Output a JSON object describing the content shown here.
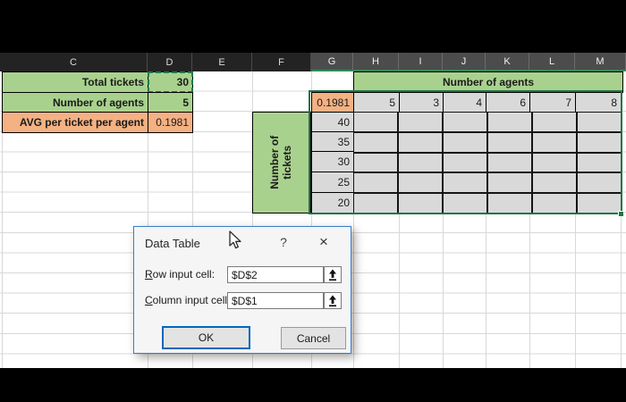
{
  "sheet": {
    "column_headers": [
      "C",
      "D",
      "E",
      "F",
      "G",
      "H",
      "I",
      "J",
      "K",
      "L",
      "M"
    ],
    "summary": {
      "rows": [
        {
          "label": "Total tickets",
          "value": "30"
        },
        {
          "label": "Number of agents",
          "value": "5"
        },
        {
          "label": "AVG per ticket per agent",
          "value": "0.1981"
        }
      ]
    },
    "data_table": {
      "column_header": "Number of agents",
      "corner_formula_value": "0.1981",
      "agent_counts": [
        "5",
        "3",
        "4",
        "6",
        "7",
        "8"
      ],
      "row_header": "Number of tickets",
      "ticket_counts": [
        "40",
        "35",
        "30",
        "25",
        "20"
      ]
    }
  },
  "dialog": {
    "title": "Data Table",
    "help_label": "?",
    "close_label": "×",
    "fields": [
      {
        "accel": "R",
        "rest": "ow input cell:",
        "value": "$D$2"
      },
      {
        "accel": "C",
        "rest": "olumn input cell:",
        "value": "$D$1"
      }
    ],
    "ok_label": "OK",
    "cancel_label": "Cancel"
  },
  "icons": {
    "range_selector": "up-arrow-from-bar",
    "help": "question-mark",
    "close": "x-mark",
    "cursor": "arrow-pointer"
  },
  "colors": {
    "cell_green": "#a9d18e",
    "cell_orange": "#f4b183",
    "cell_gray": "#d9d9d9",
    "selection_green": "#217346",
    "header_dark": "#232323",
    "header_selected": "#4c4c4c",
    "dialog_border_blue": "#3b7dc4",
    "ok_border_blue": "#0067c0"
  }
}
